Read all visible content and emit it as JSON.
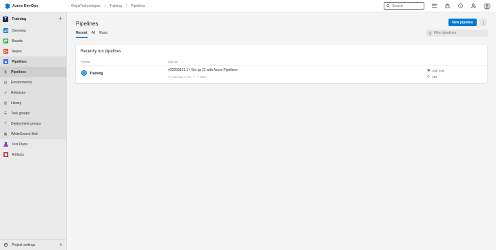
{
  "topbar": {
    "brand": "Azure DevOps",
    "breadcrumbs": [
      "OriginTechnologies",
      "Training",
      "Pipelines"
    ],
    "search_placeholder": "Search",
    "icons": [
      "list-icon",
      "bag-icon",
      "help-icon",
      "user-settings-icon"
    ]
  },
  "sidebar": {
    "project_badge": "T",
    "project_name": "Training",
    "items": [
      {
        "label": "Overview",
        "icon": "overview-icon",
        "color": "#1a73c7"
      },
      {
        "label": "Boards",
        "icon": "boards-icon",
        "color": "#2d9c3c"
      },
      {
        "label": "Repos",
        "icon": "repos-icon",
        "color": "#e0512d"
      },
      {
        "label": "Pipelines",
        "icon": "pipelines-icon",
        "color": "#2f6ce6"
      },
      {
        "label": "Pipelines"
      },
      {
        "label": "Environments"
      },
      {
        "label": "Releases"
      },
      {
        "label": "Library"
      },
      {
        "label": "Task groups"
      },
      {
        "label": "Deployment groups"
      },
      {
        "label": "WhiteSource Bolt"
      },
      {
        "label": "Test Plans",
        "icon": "test-plans-icon",
        "color": "#8d3fc9"
      },
      {
        "label": "Artifacts",
        "icon": "artifacts-icon",
        "color": "#c42f5c"
      }
    ],
    "footer": "Project settings"
  },
  "main": {
    "title": "Pipelines",
    "new_button": "New pipeline",
    "tabs": [
      "Recent",
      "All",
      "Runs"
    ],
    "filter_placeholder": "Filter pipelines",
    "card": {
      "title": "Recently run pipelines",
      "col_pipeline": "Pipeline",
      "col_last_run": "Last run",
      "row": {
        "name": "Training",
        "run_title": "#20200831.1 • Set up CI with Azure Pipelines",
        "run_trigger": "Individual CI for",
        "run_branch": "tests+",
        "time": "Just now",
        "duration": "19s"
      }
    }
  },
  "colors": {
    "accent": "#0078d4"
  }
}
